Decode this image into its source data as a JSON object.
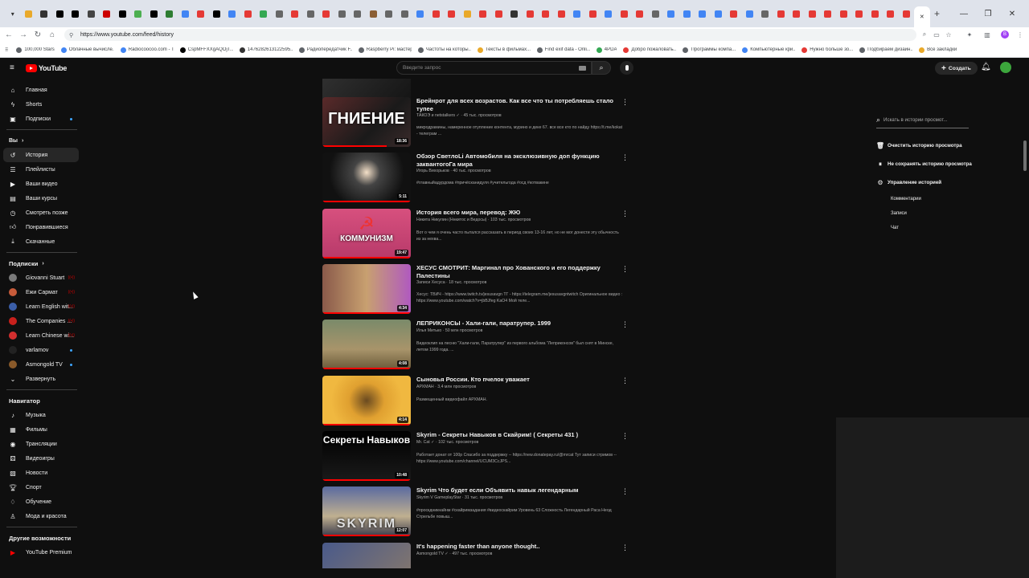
{
  "browser": {
    "url": "https://www.youtube.com/feed/history",
    "tab_count": 58,
    "bookmarks": [
      "100,000 Stars",
      "Облачные вычисле...",
      "Radiocoocoo.com - T...",
      "CspMFFXXgAQOjT...",
      "1476282613122595...",
      "Радиопередатчик F...",
      "Raspberry Pi: мастер...",
      "Частоты на которы...",
      "Тексты в фильмах...",
      "Find exif data - Onli...",
      "4PDA",
      "Добро пожаловать...",
      "Программы компа...",
      "Компьютерные кри...",
      "Нужно больше зо...",
      "Подбираем дизайн...",
      "Все закладки"
    ]
  },
  "youtube": {
    "logo_text": "YouTube",
    "search_placeholder": "Введите запрос",
    "create_label": "Создать"
  },
  "sidebar": {
    "main": [
      {
        "label": "Главная",
        "icon": "home-icon"
      },
      {
        "label": "Shorts",
        "icon": "shorts-icon"
      },
      {
        "label": "Подписки",
        "icon": "subscriptions-icon"
      }
    ],
    "you_label": "Вы",
    "you_items": [
      {
        "label": "История",
        "icon": "history-icon"
      },
      {
        "label": "Плейлисты",
        "icon": "playlists-icon"
      },
      {
        "label": "Ваши видео",
        "icon": "your-videos-icon"
      },
      {
        "label": "Ваши курсы",
        "icon": "courses-icon"
      },
      {
        "label": "Смотреть позже",
        "icon": "watch-later-icon"
      },
      {
        "label": "Понравившиеся",
        "icon": "liked-icon"
      },
      {
        "label": "Скачанные",
        "icon": "download-icon"
      }
    ],
    "subs_label": "Подписки",
    "subs": [
      "Giovanni Stuart",
      "Ежи Сармат",
      "Learn English wit...",
      "The Companies ...",
      "Learn Chinese wi...",
      "varlamov",
      "Asmongold TV"
    ],
    "expand_label": "Развернуть",
    "nav_label": "Навигатор",
    "nav_items": [
      {
        "label": "Музыка",
        "icon": "music-icon"
      },
      {
        "label": "Фильмы",
        "icon": "movies-icon"
      },
      {
        "label": "Трансляции",
        "icon": "live-icon"
      },
      {
        "label": "Видеоигры",
        "icon": "gaming-icon"
      },
      {
        "label": "Новости",
        "icon": "news-icon"
      },
      {
        "label": "Спорт",
        "icon": "sport-icon"
      },
      {
        "label": "Обучение",
        "icon": "learning-icon"
      },
      {
        "label": "Мода и красота",
        "icon": "fashion-icon"
      }
    ],
    "other_label": "Другие возможности",
    "other_items": [
      {
        "label": "YouTube Premium",
        "icon": "premium-icon"
      }
    ]
  },
  "videos": [
    {
      "title": "",
      "meta": "",
      "desc": "",
      "duration": "3:44",
      "caption": ""
    },
    {
      "title": "Брейнрот для всех возрастов. Как все что ты потребляешь стало тупее",
      "meta": "ТАКОЭ и netstalkers ✓ · 45 тыс. просмотров",
      "desc": "микродрамины, намеренное отупление контента, мурино и деке 67. все все кто по найду https://t.me/kokat - телеграм ...",
      "duration": "18:36",
      "caption": "ГНИЕНИЕ"
    },
    {
      "title": "Обзор СветлоLi Автомобиля на эксклюзивную доп функцию заквантогоГа мира",
      "meta": "Игорь Вихорьков · 40 тыс. просмотров",
      "desc": "#главныйадурдома #причёсканидуля #учительгода #осд #котвакине",
      "duration": "5:11",
      "caption": ""
    },
    {
      "title": "История всего мира, перевод: ЖЮ",
      "meta": "Никита Никулин (Ннкитос и Ведосы) · 103 тыс. просмотров",
      "desc": "Вот о чем я очень часто пытался рассказать в период своих 13-16 лет, но не мог донести эту обычность из за нехва...",
      "duration": "19:47",
      "caption": "КОММУНИЗМ"
    },
    {
      "title": "ХЕСУС СМОТРИТ: Маргинал про Хованского и его поддержку Палестины",
      "meta": "Записи Хесуса · 18 тыс. просмотров",
      "desc": "Хесус: TBИЧ - https://www.twitch.tv/jesusavgn ТГ - https://telegram.me/jesusavgntwitch Оригинальное видео : https://www.youtube.com/watch?v=jbBJfeg KaO4 Мой теле...",
      "duration": "4:34",
      "caption": ""
    },
    {
      "title": "ЛЕПРИКОНСЫ - Хали-гали, паратрупер. 1999",
      "meta": "Илья Митько · 50 млн просмотров",
      "desc": "Видеоклип на песню \"Хали-гали, Паратрупер\" из первого альбома \"Леприконсов\" был снят в Минске, летом 1999 года. ...",
      "duration": "4:08",
      "caption": ""
    },
    {
      "title": "Сыновья России. Кто пчелок уважает",
      "meta": "АРХМАН · 3,4 млн просмотров",
      "desc": "Размещенный видеофайл АРХМАН.",
      "duration": "4:14",
      "caption": ""
    },
    {
      "title": "Skyrim - Секреты Навыков в Скайрим! ( Секреты 431 )",
      "meta": "Mr. Cat ✓ · 102 тыс. просмотров",
      "desc": "Работает донат от 100р Спасибо за поддержку -- https://new.donatepay.ru/@mrcat Тут записи стримов -- https://www.youtube.com/channel/UCUM3CcJPS...",
      "duration": "10:48",
      "caption": "Секреты Навыков"
    },
    {
      "title": "Skyrim Что будет если Объявить навык легендарным",
      "meta": "Skyrim V GameplayStar · 31 тыс. просмотров",
      "desc": "#проскдникнайнм #скайримзадания #видеоскайрим Уровень 63 Сложность Легендарный Раса Неод Стрельбе повыш...",
      "duration": "12:07",
      "caption": "SKYRIM"
    },
    {
      "title": "It's happening faster than anyone thought..",
      "meta": "Asmongold TV ✓ · 497 тыс. просмотров",
      "desc": "",
      "duration": "",
      "caption": ""
    }
  ],
  "right_panel": {
    "search_placeholder": "Искать в истории просмот...",
    "clear": "Очистить историю просмотра",
    "pause": "Не сохранять историю просмотра",
    "manage": "Управление историей",
    "sub_items": [
      "Комментарии",
      "Записи",
      "Чат"
    ]
  },
  "colors": {
    "bg": "#0f0f0f",
    "accent": "#ff0000",
    "text": "#f1f1f1",
    "muted": "#aaaaaa"
  }
}
